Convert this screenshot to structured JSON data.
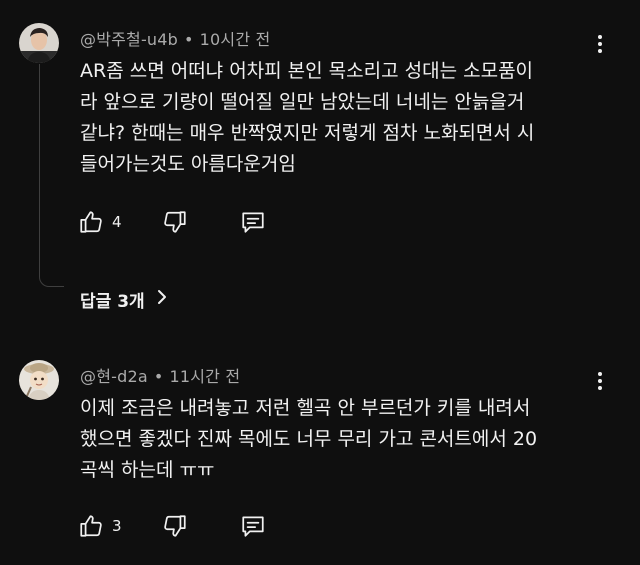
{
  "comments": [
    {
      "author": "@박주철-u4b",
      "time": "10시간 전",
      "lines": [
        "AR좀 쓰면 어떠냐 어차피 본인 목소리고 성대는 소모품이",
        "라 앞으로 기량이 떨어질 일만 남았는데 너네는 안늙을거",
        "같냐? 한때는 매우 반짝였지만 저렇게 점차 노화되면서 시",
        "들어가는것도 아름다운거임"
      ],
      "likes": "4",
      "replies_label": "답글 3개",
      "avatar_icon": "profile-photo-man"
    },
    {
      "author": "@현-d2a",
      "time": "11시간 전",
      "lines": [
        "이제 조금은 내려놓고 저런 헬곡 안 부르던가 키를 내려서",
        "했으면 좋겠다 진짜 목에도 너무 무리 가고 콘서트에서 20",
        "곡씩 하는데 ㅠㅠ"
      ],
      "likes": "3",
      "avatar_icon": "profile-photo-cartoon"
    }
  ],
  "icons": {
    "like": "thumbs-up-icon",
    "dislike": "thumbs-down-icon",
    "reply": "reply-icon",
    "more": "more-vert-icon",
    "expand": "chevron-right-icon"
  },
  "colors": {
    "background": "#0f0f0f",
    "text_primary": "#f1f1f1",
    "text_secondary": "#aaaaaa",
    "thread_line": "#3f3f3f"
  }
}
